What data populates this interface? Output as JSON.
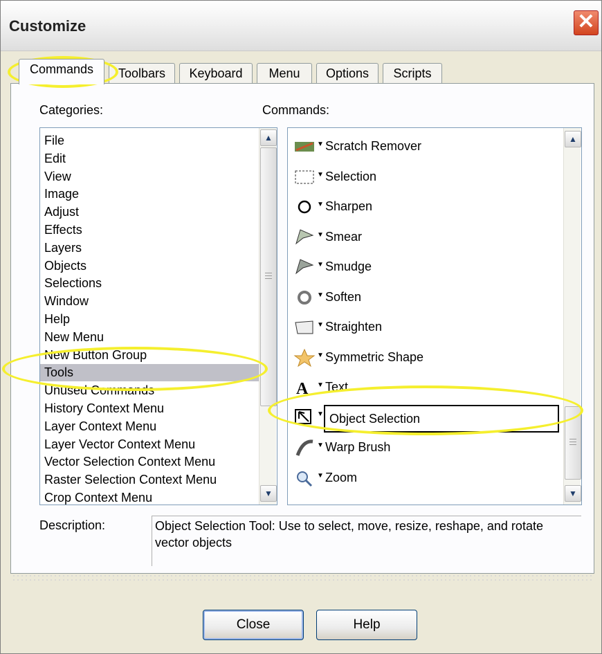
{
  "window": {
    "title": "Customize"
  },
  "tabs": [
    "Commands",
    "Toolbars",
    "Keyboard",
    "Menu",
    "Options",
    "Scripts"
  ],
  "categories": {
    "label": "Categories:",
    "items": [
      "File",
      "Edit",
      "View",
      "Image",
      "Adjust",
      "Effects",
      "Layers",
      "Objects",
      "Selections",
      "Window",
      "Help",
      "New Menu",
      "New Button Group",
      "Tools",
      "Unused Commands",
      "History Context Menu",
      "Layer Context Menu",
      "Layer Vector Context Menu",
      "Vector Selection Context Menu",
      "Raster Selection Context Menu",
      "Crop Context Menu"
    ],
    "selected": "Tools"
  },
  "commands": {
    "label": "Commands:",
    "items": [
      {
        "label": "Scratch Remover",
        "icon": "scratch-remover-icon"
      },
      {
        "label": "Selection",
        "icon": "selection-icon"
      },
      {
        "label": "Sharpen",
        "icon": "sharpen-icon"
      },
      {
        "label": "Smear",
        "icon": "smear-icon"
      },
      {
        "label": "Smudge",
        "icon": "smudge-icon"
      },
      {
        "label": "Soften",
        "icon": "soften-icon"
      },
      {
        "label": "Straighten",
        "icon": "straighten-icon"
      },
      {
        "label": "Symmetric Shape",
        "icon": "star-icon"
      },
      {
        "label": "Text",
        "icon": "text-icon"
      },
      {
        "label": "Object Selection",
        "icon": "object-selection-icon"
      },
      {
        "label": "Warp Brush",
        "icon": "warp-brush-icon"
      },
      {
        "label": "Zoom",
        "icon": "magnifier-icon"
      }
    ],
    "selected": "Object Selection"
  },
  "description": {
    "label": "Description:",
    "text": "Object Selection Tool: Use to select, move, resize, reshape, and rotate vector objects"
  },
  "buttons": {
    "close": "Close",
    "help": "Help"
  },
  "colors": {
    "highlight": "#f5ef2e",
    "selection_bg": "#c0c0c8"
  }
}
